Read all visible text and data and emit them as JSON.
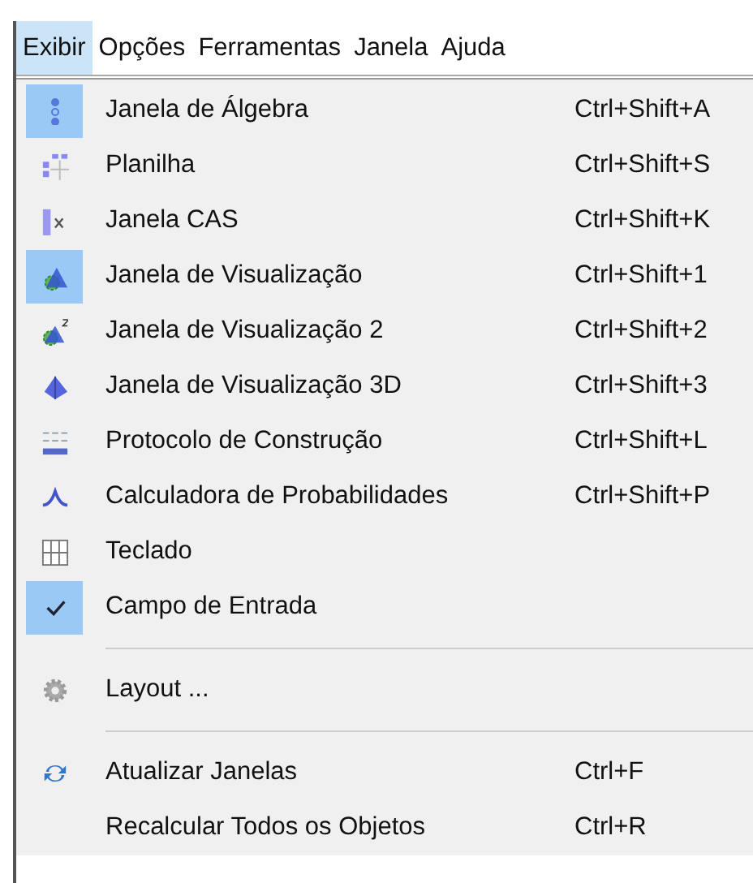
{
  "menubar": [
    {
      "label": "Exibir",
      "selected": true
    },
    {
      "label": "Opções",
      "selected": false
    },
    {
      "label": "Ferramentas",
      "selected": false
    },
    {
      "label": "Janela",
      "selected": false
    },
    {
      "label": "Ajuda",
      "selected": false
    }
  ],
  "menu": [
    {
      "kind": "toggle",
      "label": "Janela de Álgebra",
      "shortcut": "Ctrl+Shift+A",
      "checked": true
    },
    {
      "kind": "toggle",
      "label": "Planilha",
      "shortcut": "Ctrl+Shift+S",
      "checked": false
    },
    {
      "kind": "toggle",
      "label": "Janela CAS",
      "shortcut": "Ctrl+Shift+K",
      "checked": false
    },
    {
      "kind": "toggle",
      "label": "Janela de Visualização",
      "shortcut": "Ctrl+Shift+1",
      "checked": true
    },
    {
      "kind": "toggle",
      "label": "Janela de Visualização 2",
      "shortcut": "Ctrl+Shift+2",
      "checked": false
    },
    {
      "kind": "toggle",
      "label": "Janela de Visualização 3D",
      "shortcut": "Ctrl+Shift+3",
      "checked": false
    },
    {
      "kind": "toggle",
      "label": "Protocolo de Construção",
      "shortcut": "Ctrl+Shift+L",
      "checked": false
    },
    {
      "kind": "toggle",
      "label": "Calculadora de Probabilidades",
      "shortcut": "Ctrl+Shift+P",
      "checked": false
    },
    {
      "kind": "toggle",
      "label": "Teclado",
      "checked": false
    },
    {
      "kind": "toggle",
      "label": "Campo de Entrada",
      "checked": true
    },
    {
      "kind": "separator"
    },
    {
      "kind": "action",
      "label": "Layout ..."
    },
    {
      "kind": "separator"
    },
    {
      "kind": "action",
      "label": "Atualizar Janelas",
      "shortcut": "Ctrl+F"
    },
    {
      "kind": "action",
      "label": "Recalcular Todos os Objetos",
      "shortcut": "Ctrl+R"
    }
  ]
}
